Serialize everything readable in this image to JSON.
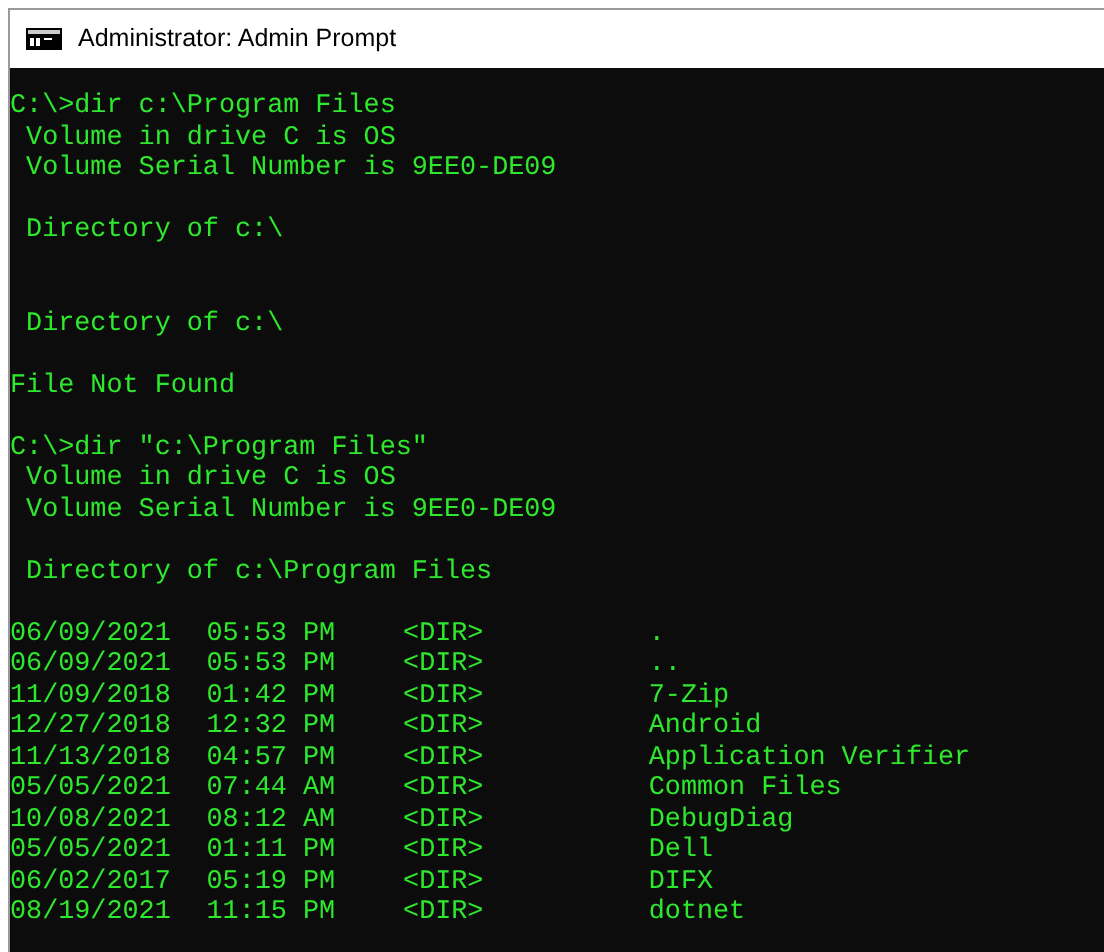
{
  "window": {
    "title": "Administrator: Admin Prompt"
  },
  "console": [
    {
      "kind": "command",
      "text": "C:\\>dir c:\\Program Files"
    },
    {
      "kind": "output",
      "text": " Volume in drive C is OS"
    },
    {
      "kind": "output",
      "text": " Volume Serial Number is 9EE0-DE09"
    },
    {
      "kind": "blank"
    },
    {
      "kind": "output",
      "text": " Directory of c:\\"
    },
    {
      "kind": "blank"
    },
    {
      "kind": "blank"
    },
    {
      "kind": "output",
      "text": " Directory of c:\\"
    },
    {
      "kind": "blank"
    },
    {
      "kind": "output",
      "text": "File Not Found"
    },
    {
      "kind": "blank"
    },
    {
      "kind": "command",
      "text": "C:\\>dir \"c:\\Program Files\""
    },
    {
      "kind": "output",
      "text": " Volume in drive C is OS"
    },
    {
      "kind": "output",
      "text": " Volume Serial Number is 9EE0-DE09"
    },
    {
      "kind": "blank"
    },
    {
      "kind": "output",
      "text": " Directory of c:\\Program Files"
    },
    {
      "kind": "blank"
    },
    {
      "kind": "entry",
      "date": "06/09/2021",
      "time": "05:53 PM",
      "type": "<DIR>",
      "name": "."
    },
    {
      "kind": "entry",
      "date": "06/09/2021",
      "time": "05:53 PM",
      "type": "<DIR>",
      "name": ".."
    },
    {
      "kind": "entry",
      "date": "11/09/2018",
      "time": "01:42 PM",
      "type": "<DIR>",
      "name": "7-Zip"
    },
    {
      "kind": "entry",
      "date": "12/27/2018",
      "time": "12:32 PM",
      "type": "<DIR>",
      "name": "Android"
    },
    {
      "kind": "entry",
      "date": "11/13/2018",
      "time": "04:57 PM",
      "type": "<DIR>",
      "name": "Application Verifier"
    },
    {
      "kind": "entry",
      "date": "05/05/2021",
      "time": "07:44 AM",
      "type": "<DIR>",
      "name": "Common Files"
    },
    {
      "kind": "entry",
      "date": "10/08/2021",
      "time": "08:12 AM",
      "type": "<DIR>",
      "name": "DebugDiag"
    },
    {
      "kind": "entry",
      "date": "05/05/2021",
      "time": "01:11 PM",
      "type": "<DIR>",
      "name": "Dell"
    },
    {
      "kind": "entry",
      "date": "06/02/2017",
      "time": "05:19 PM",
      "type": "<DIR>",
      "name": "DIFX"
    },
    {
      "kind": "entry",
      "date": "08/19/2021",
      "time": "11:15 PM",
      "type": "<DIR>",
      "name": "dotnet"
    }
  ]
}
